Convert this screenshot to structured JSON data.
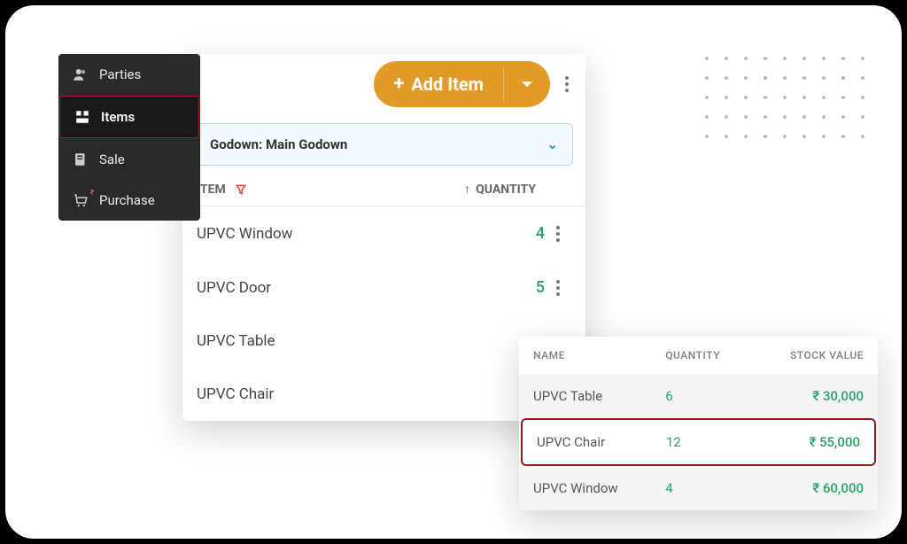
{
  "sidebar": {
    "items": [
      {
        "label": "Parties"
      },
      {
        "label": "Items"
      },
      {
        "label": "Sale"
      },
      {
        "label": "Purchase"
      }
    ]
  },
  "items_panel": {
    "add_button": "Add Item",
    "godown_label": "Godown: Main Godown",
    "headers": {
      "item": "ITEM",
      "quantity": "QUANTITY"
    },
    "rows": [
      {
        "name": "UPVC  Window",
        "qty": "4"
      },
      {
        "name": "UPVC Door",
        "qty": "5"
      },
      {
        "name": "UPVC Table",
        "qty": ""
      },
      {
        "name": "UPVC Chair",
        "qty": ""
      }
    ]
  },
  "stock_panel": {
    "headers": {
      "name": "NAME",
      "quantity": "QUANTITY",
      "value": "STOCK VALUE"
    },
    "rows": [
      {
        "name": "UPVC Table",
        "qty": "6",
        "value": "₹ 30,000"
      },
      {
        "name": "UPVC Chair",
        "qty": "12",
        "value": "₹ 55,000"
      },
      {
        "name": "UPVC  Window",
        "qty": "4",
        "value": "₹ 60,000"
      }
    ]
  }
}
